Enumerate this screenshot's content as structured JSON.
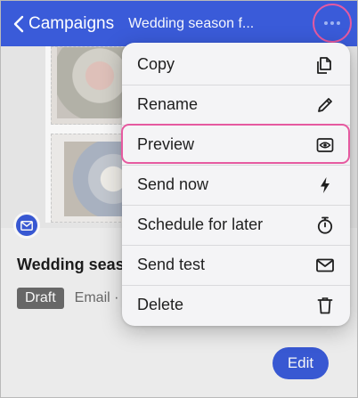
{
  "header": {
    "back_label": "Campaigns",
    "title": "Wedding season f...",
    "more_icon": "more-horizontal-icon"
  },
  "campaign": {
    "name": "Wedding seaso",
    "status": "Draft",
    "type": "Email ·",
    "edit_label": "Edit"
  },
  "menu": {
    "items": [
      {
        "label": "Copy",
        "icon": "copy-icon"
      },
      {
        "label": "Rename",
        "icon": "pencil-icon"
      },
      {
        "label": "Preview",
        "icon": "eye-icon"
      },
      {
        "label": "Send now",
        "icon": "lightning-icon"
      },
      {
        "label": "Schedule for later",
        "icon": "stopwatch-icon"
      },
      {
        "label": "Send test",
        "icon": "envelope-icon"
      },
      {
        "label": "Delete",
        "icon": "trash-icon"
      }
    ]
  },
  "colors": {
    "brand": "#3a5bd9",
    "highlight": "#e65aa0"
  }
}
